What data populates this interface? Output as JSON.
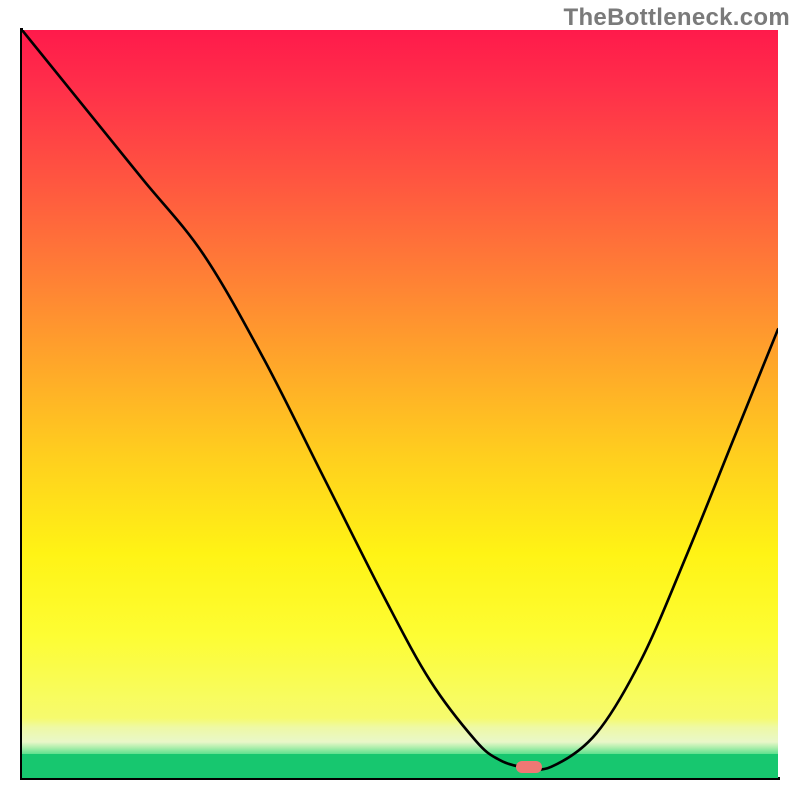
{
  "watermark": "TheBottleneck.com",
  "colors": {
    "pill": "#ef7874",
    "curve": "#000000"
  },
  "chart_data": {
    "type": "line",
    "title": "",
    "xlabel": "",
    "ylabel": "",
    "xlim": [
      0,
      100
    ],
    "ylim": [
      0,
      100
    ],
    "grid": false,
    "legend": false,
    "series": [
      {
        "name": "bottleneck-curve",
        "x": [
          0,
          8,
          16,
          24,
          32,
          40,
          48,
          54,
          60,
          63,
          66,
          70,
          76,
          82,
          88,
          94,
          100
        ],
        "y": [
          100,
          90,
          80,
          70,
          56,
          40,
          24,
          13,
          5,
          2.5,
          1.5,
          1.5,
          6,
          16,
          30,
          45,
          60
        ]
      }
    ],
    "series_comment": "y is visual height above x-axis as % of plot height — estimated from gridless figure; the curve descends from top-left, bows slightly around x≈24, dives to a floor near x≈63–70, then rises to the right edge at about 60% height.",
    "marker": {
      "name": "valley-marker",
      "x": 67,
      "y": 1.5,
      "shape": "pill",
      "color": "#ef7874"
    },
    "background_gradient": {
      "orientation": "vertical",
      "stops": [
        {
          "pos": 0.0,
          "color": "#ff1a4b"
        },
        {
          "pos": 0.22,
          "color": "#ff5640"
        },
        {
          "pos": 0.48,
          "color": "#ffa52a"
        },
        {
          "pos": 0.76,
          "color": "#fff315"
        },
        {
          "pos": 0.92,
          "color": "#f6fb6e"
        },
        {
          "pos": 0.955,
          "color": "#e9f7c9"
        },
        {
          "pos": 0.968,
          "color": "#5fe18f"
        },
        {
          "pos": 1.0,
          "color": "#17c76f"
        }
      ]
    }
  }
}
